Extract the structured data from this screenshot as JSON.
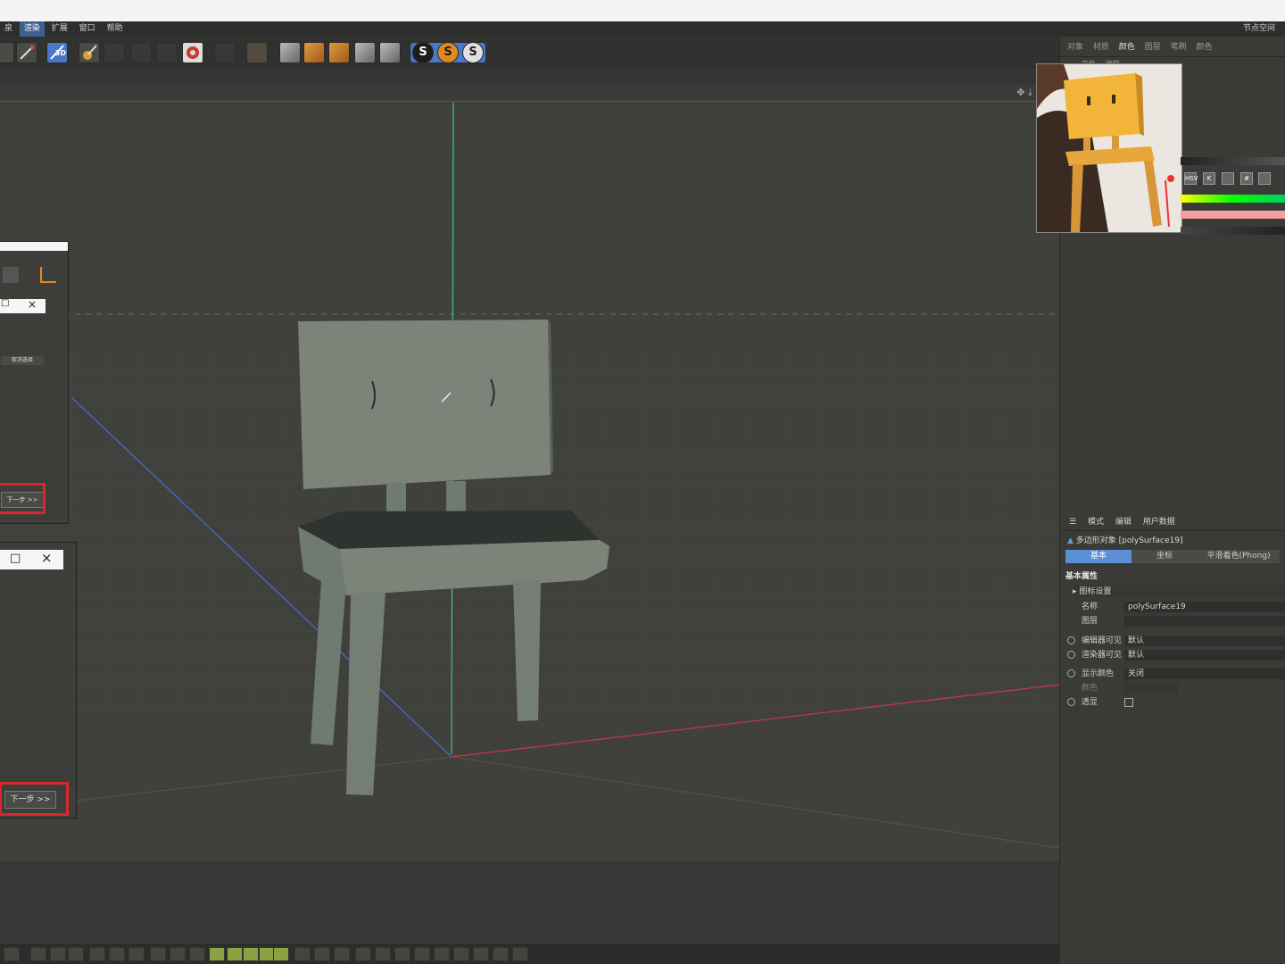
{
  "menu": {
    "items": [
      "泉",
      "渲染",
      "扩展",
      "窗口",
      "帮助"
    ],
    "active_index": 1,
    "right_label": "节点空间"
  },
  "toolbar": {
    "s_buttons": [
      "S",
      "S",
      "S"
    ],
    "label_3d": "3D"
  },
  "right_panel": {
    "tabs": [
      "对象",
      "材质",
      "颜色",
      "图层",
      "笔刷",
      "颜色"
    ],
    "active_tab": 2,
    "sub_tabs": [
      "文件",
      "编辑"
    ],
    "color_buttons": [
      "HSV",
      "K",
      "",
      "#",
      ""
    ]
  },
  "attributes": {
    "header": [
      "模式",
      "编辑",
      "用户数据"
    ],
    "object_title": "多边形对象 [polySurface19]",
    "tabs": [
      "基本",
      "坐标",
      "平滑着色(Phong)"
    ],
    "section": "基本属性",
    "subsection": "图标设置",
    "name_label": "名称",
    "name_value": "polySurface19",
    "layer_label": "图层",
    "editor_visible_label": "编辑器可见",
    "editor_visible_value": "默认",
    "render_visible_label": "渲染器可见",
    "render_visible_value": "默认",
    "display_color_label": "显示颜色",
    "display_color_value": "关闭",
    "color_label": "颜色",
    "xray_label": "透显"
  },
  "dialogs": {
    "upper": {
      "cancel_label": "取消选择",
      "next_label": "下一步 >>"
    },
    "lower": {
      "next_label": "下一步 >>"
    },
    "close_glyph": "×",
    "max_glyph": "□"
  },
  "colors": {
    "accent_blue": "#5b8fd6",
    "highlight_red": "#d8282d",
    "axis_green": "#3fbf9a",
    "axis_red": "#c8384a",
    "axis_blue": "#4a6ad8",
    "chair": "#6f7a70"
  }
}
